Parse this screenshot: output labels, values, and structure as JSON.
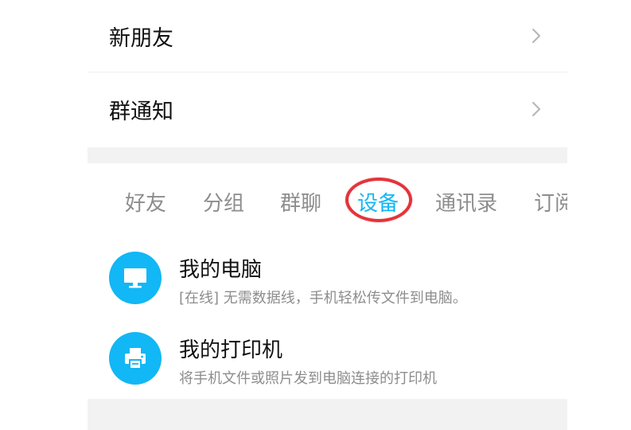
{
  "contacts_menu": {
    "rows": [
      {
        "label": "新朋友"
      },
      {
        "label": "群通知"
      }
    ]
  },
  "tabs": {
    "items": [
      {
        "label": "好友"
      },
      {
        "label": "分组"
      },
      {
        "label": "群聊"
      },
      {
        "label": "设备"
      },
      {
        "label": "通讯录"
      },
      {
        "label": "订阅"
      }
    ],
    "active": "设备"
  },
  "devices": [
    {
      "title": "我的电脑",
      "description": "[在线] 无需数据线，手机轻松传文件到电脑。",
      "icon": "monitor-icon"
    },
    {
      "title": "我的打印机",
      "description": "将手机文件或照片发到电脑连接的打印机",
      "icon": "printer-icon"
    }
  ],
  "colors": {
    "accent": "#12b7f5",
    "highlight": "#e4343b",
    "text_primary": "#111111",
    "text_secondary": "#8d8d8d",
    "page_background": "#f2f2f2"
  }
}
